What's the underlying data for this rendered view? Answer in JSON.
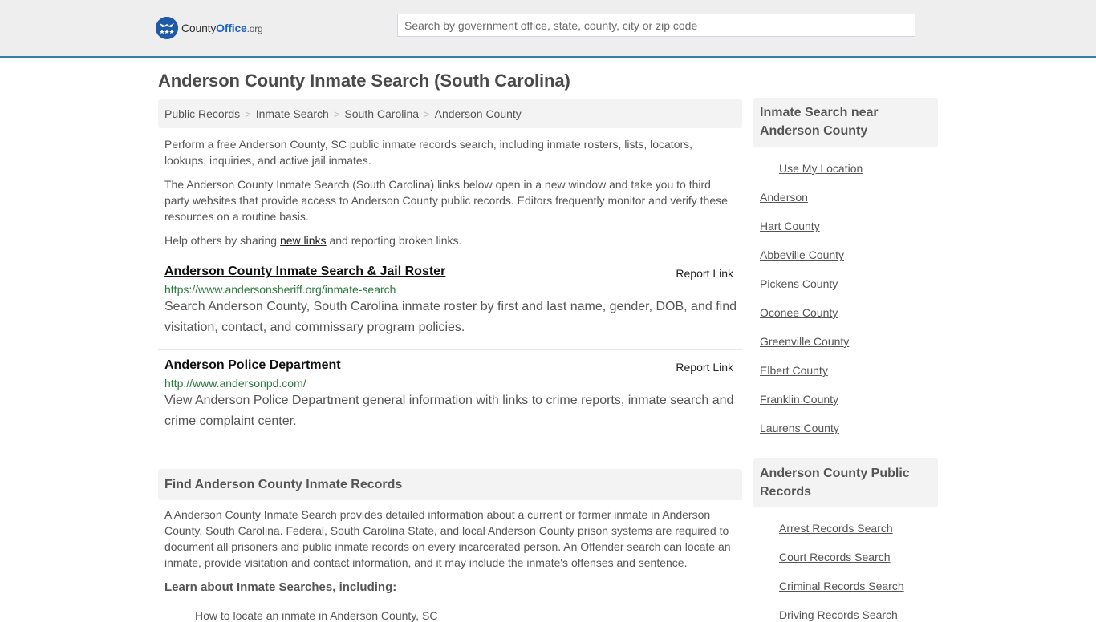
{
  "header": {
    "logo": {
      "prefix": "County",
      "brand": "Office",
      "tld": ".org",
      "icon": "eagle-stars-badge"
    },
    "search_placeholder": "Search by government office, state, county, city or zip code",
    "accent_color": "#3a7cab"
  },
  "page_title": "Anderson County Inmate Search (South Carolina)",
  "breadcrumb": {
    "items": [
      "Public Records",
      "Inmate Search",
      "South Carolina",
      "Anderson County"
    ],
    "separator": ">"
  },
  "intro": {
    "p1": "Perform a free Anderson County, SC public inmate records search, including inmate rosters, lists, locators, lookups, inquiries, and active jail inmates.",
    "p2": "The Anderson County Inmate Search (South Carolina) links below open in a new window and take you to third party websites that provide access to Anderson County public records. Editors frequently monitor and verify these resources on a routine basis.",
    "p3_before": "Help others by sharing ",
    "p3_link": "new links",
    "p3_after": " and reporting broken links."
  },
  "results": [
    {
      "title": "Anderson County Inmate Search & Jail Roster",
      "report": "Report Link",
      "url": "https://www.andersonsheriff.org/inmate-search",
      "description": "Search Anderson County, South Carolina inmate roster by first and last name, gender, DOB, and find visitation, contact, and commissary program policies."
    },
    {
      "title": "Anderson Police Department",
      "report": "Report Link",
      "url": "http://www.andersonpd.com/",
      "description": "View Anderson Police Department general information with links to crime reports, inmate search and crime complaint center."
    }
  ],
  "find_section": {
    "heading": "Find Anderson County Inmate Records",
    "body": "A Anderson County Inmate Search provides detailed information about a current or former inmate in Anderson County, South Carolina. Federal, South Carolina State, and local Anderson County prison systems are required to document all prisoners and public inmate records on every incarcerated person. An Offender search can locate an inmate, provide visitation and contact information, and it may include the inmate's offenses and sentence.",
    "subheading": "Learn about Inmate Searches, including:",
    "first_item_partial": "How to locate an inmate in Anderson County, SC"
  },
  "sidebar": {
    "nearby": {
      "heading": "Inmate Search near Anderson County",
      "use_location": "Use My Location",
      "links": [
        "Anderson",
        "Hart County",
        "Abbeville County",
        "Pickens County",
        "Oconee County",
        "Greenville County",
        "Elbert County",
        "Franklin County",
        "Laurens County"
      ]
    },
    "public_records": {
      "heading": "Anderson County Public Records",
      "links": [
        "Arrest Records Search",
        "Court Records Search",
        "Criminal Records Search",
        "Driving Records Search"
      ]
    }
  }
}
